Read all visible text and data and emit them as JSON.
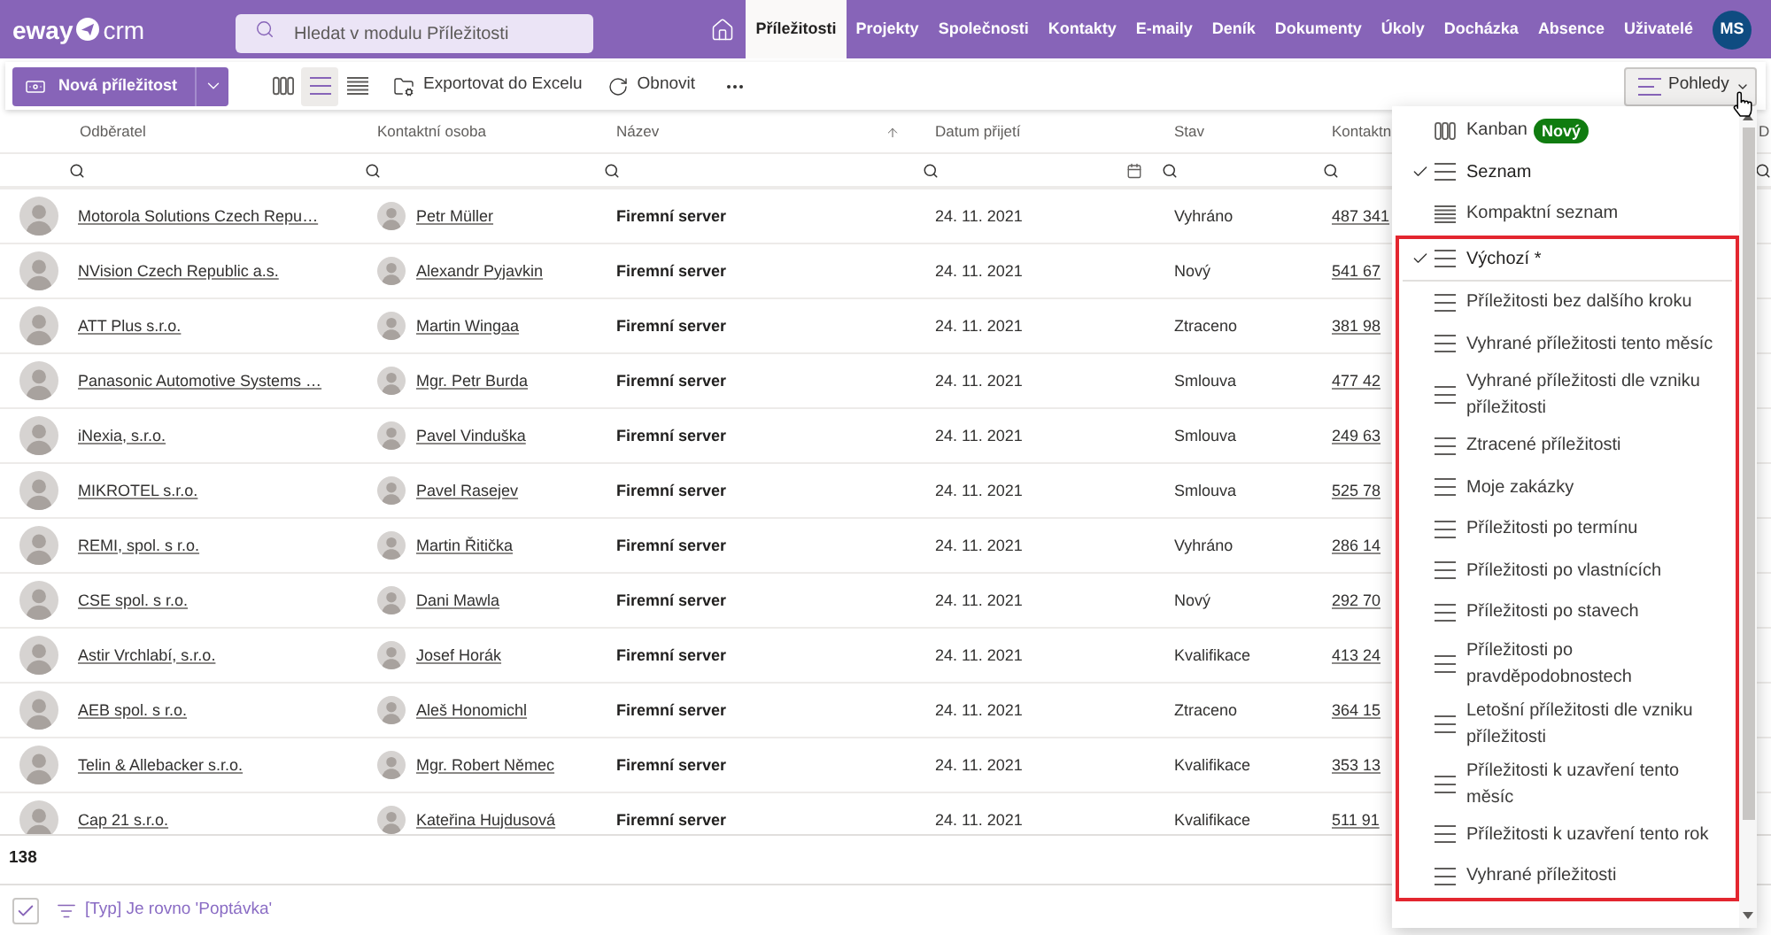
{
  "header": {
    "logo": {
      "brand": "eway",
      "product": "crm"
    },
    "search": {
      "placeholder": "Hledat v modulu Příležitosti"
    },
    "modules": [
      {
        "label": "Příležitosti",
        "selected": true
      },
      {
        "label": "Projekty",
        "selected": false
      },
      {
        "label": "Společnosti",
        "selected": false
      },
      {
        "label": "Kontakty",
        "selected": false
      },
      {
        "label": "E-maily",
        "selected": false
      },
      {
        "label": "Deník",
        "selected": false
      },
      {
        "label": "Dokumenty",
        "selected": false
      },
      {
        "label": "Úkoly",
        "selected": false
      },
      {
        "label": "Docházka",
        "selected": false
      },
      {
        "label": "Absence",
        "selected": false
      },
      {
        "label": "Uživatelé",
        "selected": false
      }
    ],
    "user": {
      "initials": "MS"
    }
  },
  "toolbar": {
    "new_button": {
      "label": "Nová příležitost"
    },
    "view_modes": [
      {
        "kind": "kanban",
        "selected": false
      },
      {
        "kind": "list",
        "selected": true
      },
      {
        "kind": "compact",
        "selected": false
      }
    ],
    "actions": [
      {
        "kind": "export",
        "label": "Exportovat do Excelu"
      },
      {
        "kind": "refresh",
        "label": "Obnovit"
      },
      {
        "kind": "more"
      }
    ],
    "views_button": {
      "label": "Pohledy",
      "expanded": true
    }
  },
  "table": {
    "columns": [
      {
        "label": "Odběratel",
        "kind": "search",
        "sorted": false
      },
      {
        "label": "Kontaktní osoba",
        "kind": "search",
        "sorted": false
      },
      {
        "label": "Název",
        "kind": "search",
        "sorted": true
      },
      {
        "label": "Datum přijetí",
        "kind": "date",
        "sorted": false
      },
      {
        "label": "Stav",
        "kind": "search",
        "sorted": false
      },
      {
        "label": "Kontaktn",
        "kind": "search",
        "sorted": false
      },
      {
        "label": "D",
        "kind": "search",
        "sorted": false
      }
    ],
    "rows": [
      {
        "company": "Motorola Solutions Czech Repu…",
        "contact": "Petr Müller",
        "name": "Firemní server",
        "received": "24. 11. 2021",
        "status": "Vyhráno",
        "column_6": "487 341"
      },
      {
        "company": "NVision Czech Republic a.s.",
        "contact": "Alexandr Pyjavkin",
        "name": "Firemní server",
        "received": "24. 11. 2021",
        "status": "Nový",
        "column_6": "541 67"
      },
      {
        "company": "ATT Plus s.r.o.",
        "contact": "Martin Wingaa",
        "name": "Firemní server",
        "received": "24. 11. 2021",
        "status": "Ztraceno",
        "column_6": "381 98"
      },
      {
        "company": "Panasonic Automotive Systems …",
        "contact": "Mgr. Petr Burda",
        "name": "Firemní server",
        "received": "24. 11. 2021",
        "status": "Smlouva",
        "column_6": "477 42"
      },
      {
        "company": "iNexia, s.r.o.",
        "contact": "Pavel Vinduška",
        "name": "Firemní server",
        "received": "24. 11. 2021",
        "status": "Smlouva",
        "column_6": "249 63"
      },
      {
        "company": "MIKROTEL s.r.o.",
        "contact": "Pavel Rasejev",
        "name": "Firemní server",
        "received": "24. 11. 2021",
        "status": "Smlouva",
        "column_6": "525 78"
      },
      {
        "company": "REMI, spol. s r.o.",
        "contact": "Martin Řitička",
        "name": "Firemní server",
        "received": "24. 11. 2021",
        "status": "Vyhráno",
        "column_6": "286 14"
      },
      {
        "company": "CSE spol. s r.o.",
        "contact": "Dani Mawla",
        "name": "Firemní server",
        "received": "24. 11. 2021",
        "status": "Nový",
        "column_6": "292 70"
      },
      {
        "company": "Astir Vrchlabí, s.r.o.",
        "contact": "Josef Horák",
        "name": "Firemní server",
        "received": "24. 11. 2021",
        "status": "Kvalifikace",
        "column_6": "413 24"
      },
      {
        "company": "AEB spol. s r.o.",
        "contact": "Aleš Honomichl",
        "name": "Firemní server",
        "received": "24. 11. 2021",
        "status": "Ztraceno",
        "column_6": "364 15"
      },
      {
        "company": "Telin & Allebacker s.r.o.",
        "contact": "Mgr. Robert Němec",
        "name": "Firemní server",
        "received": "24. 11. 2021",
        "status": "Kvalifikace",
        "column_6": "353 13"
      },
      {
        "company": "Cap 21 s.r.o.",
        "contact": "Kateřina Hujdusová",
        "name": "Firemní server",
        "received": "24. 11. 2021",
        "status": "Kvalifikace",
        "column_6": "511 91"
      }
    ]
  },
  "footer": {
    "count": "138"
  },
  "filter_bar": {
    "enabled": true,
    "text": "[Typ] Je rovno 'Poptávka'"
  },
  "views_menu": {
    "layouts": [
      {
        "kind": "kanban",
        "label": "Kanban",
        "badge": "Nový",
        "selected": false
      },
      {
        "kind": "list",
        "label": "Seznam",
        "selected": true
      },
      {
        "kind": "compact",
        "label": "Kompaktní seznam",
        "selected": false
      }
    ],
    "saved_views": [
      {
        "label": "Výchozí *",
        "selected": true
      },
      {
        "label": "Příležitosti bez dalšího kroku",
        "selected": false
      },
      {
        "label": "Vyhrané příležitosti tento měsíc",
        "selected": false
      },
      {
        "label": "Vyhrané příležitosti dle vzniku příležitosti",
        "selected": false
      },
      {
        "label": "Ztracené příležitosti",
        "selected": false
      },
      {
        "label": "Moje zakázky",
        "selected": false
      },
      {
        "label": "Příležitosti po termínu",
        "selected": false
      },
      {
        "label": "Příležitosti po vlastnících",
        "selected": false
      },
      {
        "label": "Příležitosti po stavech",
        "selected": false
      },
      {
        "label": "Příležitosti po pravděpodobnostech",
        "selected": false
      },
      {
        "label": "Letošní příležitosti dle vzniku příležitosti",
        "selected": false
      },
      {
        "label": "Příležitosti k uzavření tento měsíc",
        "selected": false
      },
      {
        "label": "Příležitosti k uzavření tento rok",
        "selected": false
      },
      {
        "label": "Vyhrané příležitosti",
        "selected": false
      }
    ]
  }
}
